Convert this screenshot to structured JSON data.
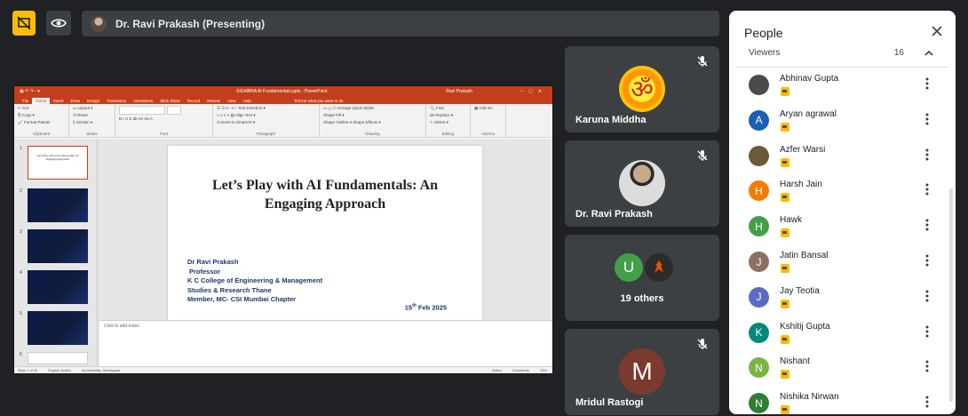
{
  "topbar": {
    "presenter_label": "Dr. Ravi Prakash (Presenting)"
  },
  "powerpoint": {
    "file_title": "SIGMBRA AI Fundamentals.pptx - PowerPoint",
    "user_name": "Ravi Prakash",
    "tabs": [
      "File",
      "Home",
      "Insert",
      "Draw",
      "Design",
      "Transitions",
      "Animations",
      "Slide Show",
      "Record",
      "Review",
      "View",
      "Help"
    ],
    "tell_me": "Tell me what you want to do",
    "ribbon_groups": [
      "Clipboard",
      "Slides",
      "Font",
      "Paragraph",
      "Drawing",
      "Editing",
      "Add-ins"
    ],
    "thumb1_text": "Let's Play with AI Fundamentals: An Engaging Approach",
    "thumb_numbers": [
      "1",
      "2",
      "3",
      "4",
      "5",
      "6"
    ],
    "slide": {
      "title": "Let’s Play with AI Fundamentals: An Engaging Approach",
      "lines": [
        "Dr Ravi Prakash",
        "Professor",
        "K C College of Engineering & Management",
        "Studies & Research Thane",
        "Member, MC- CSI Mumbai Chapter"
      ],
      "date_day": "15",
      "date_sup": "th",
      "date_rest": " Feb 2025"
    },
    "notes_placeholder": "Click to add notes",
    "status": {
      "slide_count": "Slide 1 of 20",
      "language": "English (India)",
      "accessibility": "Accessibility: Investigate",
      "notes": "Notes",
      "comments": "Comments",
      "zoom": "78%"
    }
  },
  "tiles": [
    {
      "name": "Karuna Middha"
    },
    {
      "name": "Dr. Ravi Prakash"
    },
    {
      "name": "19 others",
      "initial": "U"
    },
    {
      "name": "Mridul Rastogi",
      "initial": "M"
    }
  ],
  "people_panel": {
    "title": "People",
    "section": "Viewers",
    "count": "16",
    "people": [
      {
        "name": "Abhinav Gupta",
        "initial": "",
        "color": "#4a4a4a"
      },
      {
        "name": "Aryan agrawal",
        "initial": "A",
        "color": "#1a5fb4"
      },
      {
        "name": "Azfer Warsi",
        "initial": "",
        "color": "#6b5a3a"
      },
      {
        "name": "Harsh Jain",
        "initial": "H",
        "color": "#f57c00"
      },
      {
        "name": "Hawk",
        "initial": "H",
        "color": "#43a047"
      },
      {
        "name": "Jatin Bansal",
        "initial": "J",
        "color": "#8d6e63"
      },
      {
        "name": "Jay Teotia",
        "initial": "J",
        "color": "#5c6bc0"
      },
      {
        "name": "Kshitij Gupta",
        "initial": "K",
        "color": "#00897b"
      },
      {
        "name": "Nishant",
        "initial": "N",
        "color": "#7cb342"
      },
      {
        "name": "Nishika Nirwan",
        "initial": "N",
        "color": "#2e7d32"
      }
    ]
  }
}
